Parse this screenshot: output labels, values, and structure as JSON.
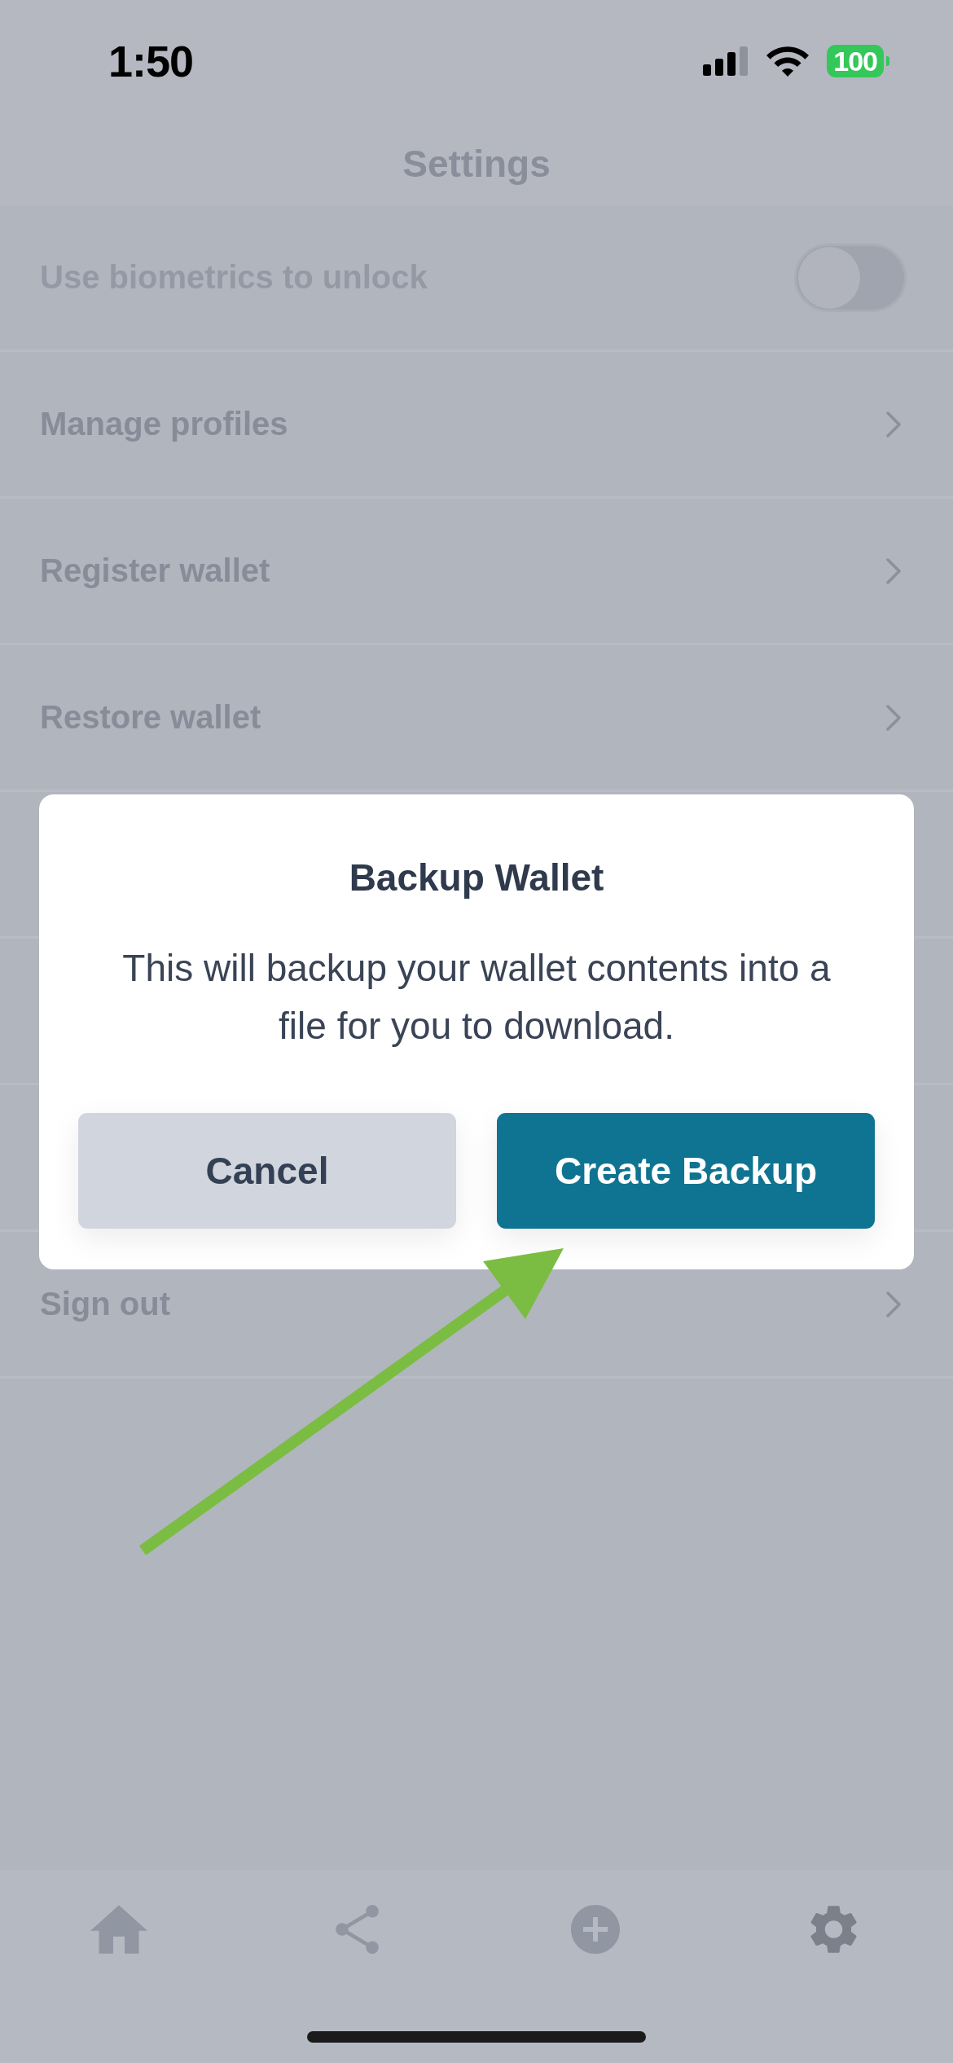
{
  "status_bar": {
    "time": "1:50",
    "battery": "100"
  },
  "header": {
    "title": "Settings"
  },
  "settings_above_dialog": [
    {
      "kind": "toggle",
      "label": "Use biometrics to unlock",
      "disabled": true,
      "on": false
    },
    {
      "kind": "link",
      "label": "Manage profiles",
      "disabled": false
    },
    {
      "kind": "link",
      "label": "Register wallet",
      "disabled": false
    },
    {
      "kind": "link",
      "label": "Restore wallet",
      "disabled": false
    }
  ],
  "settings_below_dialog": [
    {
      "kind": "link",
      "label": "Sign out",
      "disabled": false
    }
  ],
  "dialog": {
    "title": "Backup Wallet",
    "message": "This will backup your wallet contents into a file for you to download.",
    "buttons": [
      {
        "kind": "secondary",
        "label": "Cancel"
      },
      {
        "kind": "primary",
        "label": "Create Backup"
      }
    ]
  },
  "tab_bar": [
    {
      "kind": "home",
      "selected": false
    },
    {
      "kind": "share",
      "selected": false
    },
    {
      "kind": "add",
      "selected": false
    },
    {
      "kind": "settings",
      "selected": true
    }
  ]
}
